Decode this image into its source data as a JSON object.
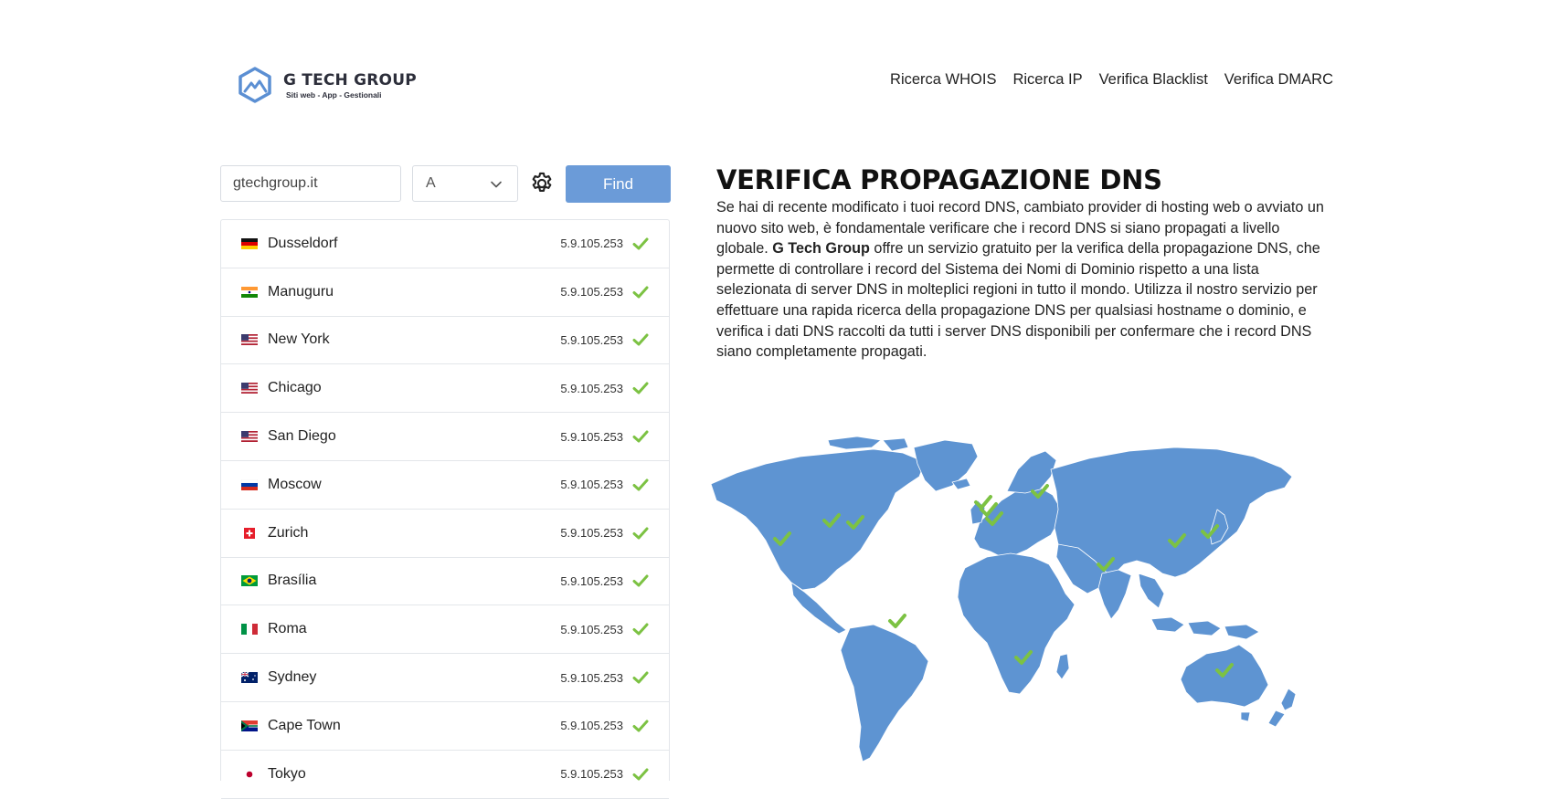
{
  "brand": {
    "name": "G TECH GROUP",
    "tagline": "Siti web - App - Gestionali",
    "color": "#5b8fd3"
  },
  "nav": [
    {
      "label": "Ricerca WHOIS"
    },
    {
      "label": "Ricerca IP"
    },
    {
      "label": "Verifica Blacklist"
    },
    {
      "label": "Verifica DMARC"
    }
  ],
  "search": {
    "domain_value": "gtechgroup.it",
    "record_type": "A",
    "find_label": "Find",
    "accent": "#6b9bd8"
  },
  "results": [
    {
      "city": "Dusseldorf",
      "flag": "de",
      "ip": "5.9.105.253"
    },
    {
      "city": "Manuguru",
      "flag": "in",
      "ip": "5.9.105.253"
    },
    {
      "city": "New York",
      "flag": "us",
      "ip": "5.9.105.253"
    },
    {
      "city": "Chicago",
      "flag": "us",
      "ip": "5.9.105.253"
    },
    {
      "city": "San Diego",
      "flag": "us",
      "ip": "5.9.105.253"
    },
    {
      "city": "Moscow",
      "flag": "ru",
      "ip": "5.9.105.253"
    },
    {
      "city": "Zurich",
      "flag": "ch",
      "ip": "5.9.105.253"
    },
    {
      "city": "Brasília",
      "flag": "br",
      "ip": "5.9.105.253"
    },
    {
      "city": "Roma",
      "flag": "it",
      "ip": "5.9.105.253"
    },
    {
      "city": "Sydney",
      "flag": "au",
      "ip": "5.9.105.253"
    },
    {
      "city": "Cape Town",
      "flag": "za",
      "ip": "5.9.105.253"
    },
    {
      "city": "Tokyo",
      "flag": "jp",
      "ip": "5.9.105.253"
    }
  ],
  "status_color": "#7cc243",
  "main": {
    "title": "VERIFICA PROPAGAZIONE DNS",
    "desc_part1": "Se hai di recente modificato i tuoi record DNS, cambiato provider di hosting web o avviato un nuovo sito web, è fondamentale verificare che i record DNS si siano propagati a livello globale. ",
    "desc_bold": "G Tech Group",
    "desc_part2": " offre un servizio gratuito per la verifica della propagazione DNS, che permette di controllare i record del Sistema dei Nomi di Dominio rispetto a una lista selezionata di server DNS in molteplici regioni in tutto il mondo. Utilizza il nostro servizio per effettuare una rapida ricerca della propagazione DNS per qualsiasi hostname o dominio, e verifica i dati DNS raccolti da tutti i server DNS disponibili per confermare che i record DNS siano completamente propagati."
  },
  "map": {
    "land_color": "#5e94d2",
    "marker_icon": "check-icon"
  }
}
